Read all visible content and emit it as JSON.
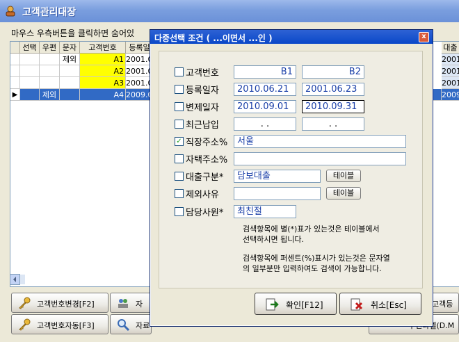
{
  "window": {
    "title": "고객관리대장"
  },
  "hint": "마우스 우측버튼을 클릭하면 숨어있",
  "grid": {
    "headers": [
      "선택",
      "우편",
      "문자",
      "고객번호",
      "등록일"
    ],
    "right_header": "대출",
    "rows": [
      {
        "uphyeon": "",
        "munja": "제외",
        "code": "A1",
        "date": "2001.0",
        "right": "2001"
      },
      {
        "uphyeon": "",
        "munja": "",
        "code": "A2",
        "date": "2001.0",
        "right": "2001"
      },
      {
        "uphyeon": "",
        "munja": "",
        "code": "A3",
        "date": "2001.0",
        "right": "2001"
      },
      {
        "uphyeon": "제외",
        "munja": "",
        "code": "A4",
        "date": "2009.0",
        "right": "2009"
      }
    ],
    "current_row_marker": "▶"
  },
  "bottom_buttons": {
    "code_change": "고객번호변경[F2]",
    "code_auto": "고객번호자동[F3]",
    "partial1": "자",
    "partial2": "자료검색[F5]",
    "partial3": "고객등",
    "partial4": "우편라벨(D.M"
  },
  "dialog": {
    "title": "다중선택 조건 ( ...이면서 ...인 )",
    "close": "x",
    "rows": [
      {
        "label": "고객번호",
        "checked": false,
        "v1": "B1",
        "v2": "B2"
      },
      {
        "label": "등록일자",
        "checked": false,
        "v1": "2010.06.21",
        "v2": "2001.06.23"
      },
      {
        "label": "변제일자",
        "checked": false,
        "v1": "2010.09.01",
        "v2": "2010.09.31"
      },
      {
        "label": "최근납입",
        "checked": false,
        "v1": ".  .",
        "v2": ".  ."
      },
      {
        "label": "직장주소%",
        "checked": true,
        "v1": "서울"
      },
      {
        "label": "자택주소%",
        "checked": false,
        "v1": ""
      },
      {
        "label": "대출구분*",
        "checked": false,
        "v1": "담보대출",
        "button": "테이블"
      },
      {
        "label": "제외사유",
        "checked": false,
        "v1": "",
        "button": "테이블"
      },
      {
        "label": "담당사원*",
        "checked": false,
        "v1": "최친절"
      }
    ],
    "note1_line1": "검색항목에 별(*)표가 있는것은 테이블에서",
    "note1_line2": "선택하시면 됩니다.",
    "note2_line1": "검색항목에 퍼센트(%)표시가 있는것은 문자열",
    "note2_line2": "의 일부분만 입력하여도 검색이 가능합니다.",
    "ok_label": "확인[F12]",
    "cancel_label": "취소[Esc]"
  },
  "colors": {
    "accent": "#0A48C8",
    "highlight": "#FFFF00",
    "selected": "#316AC5",
    "value_text": "#1A3FA8"
  }
}
